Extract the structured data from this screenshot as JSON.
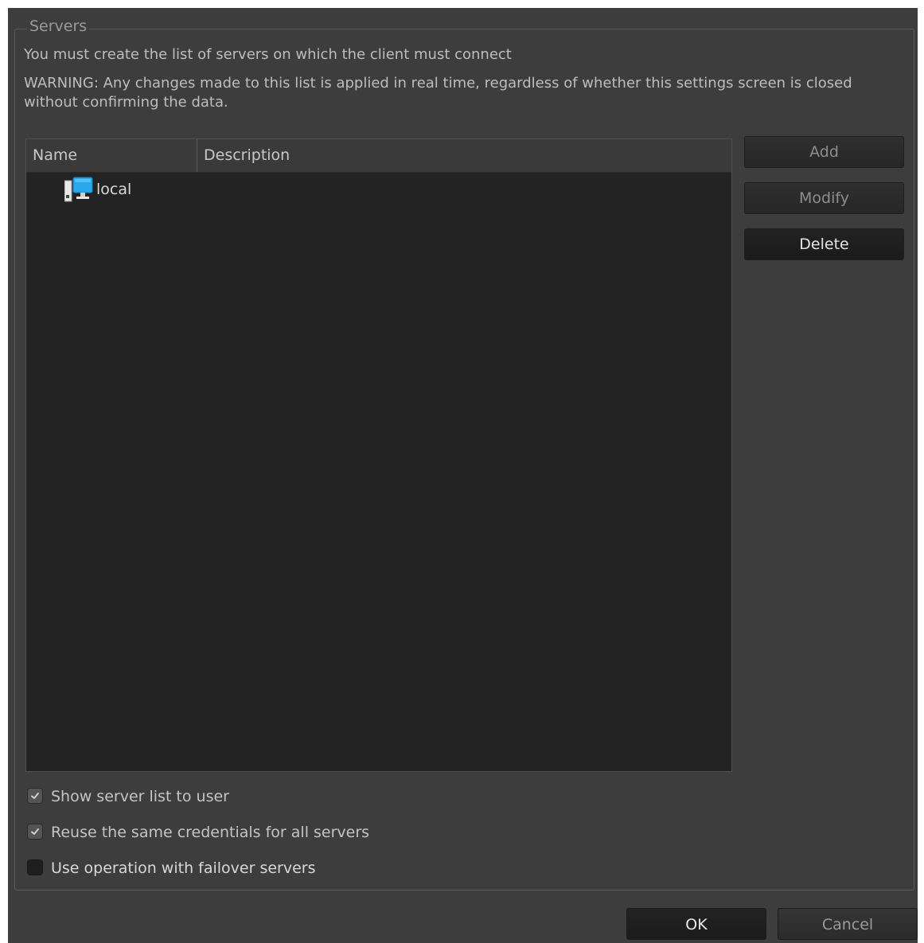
{
  "groupbox": {
    "title": "Servers",
    "info_text": "You must create the list of servers on which the client must connect",
    "warning_text": "WARNING: Any changes made to this list is applied in real time, regardless of whether this settings screen is closed without confirming the data."
  },
  "server_list": {
    "columns": [
      "Name",
      "Description"
    ],
    "rows": [
      {
        "name": "local",
        "description": "",
        "icon": "server-computer-icon"
      }
    ]
  },
  "side_buttons": {
    "add_label": "Add",
    "modify_label": "Modify",
    "delete_label": "Delete"
  },
  "options": [
    {
      "label": "Show server list to user",
      "checked": true
    },
    {
      "label": "Reuse the same credentials for all servers",
      "checked": true
    },
    {
      "label": "Use operation with failover servers",
      "checked": false
    }
  ],
  "footer": {
    "ok_label": "OK",
    "cancel_label": "Cancel"
  },
  "colors": {
    "window_bg": "#3d3d3d",
    "list_bg": "#232323",
    "icon_blue": "#29a9ec"
  }
}
